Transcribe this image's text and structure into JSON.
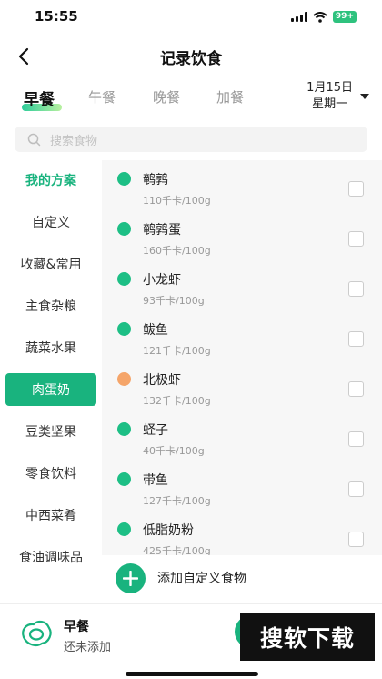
{
  "status_bar": {
    "time": "15:55",
    "battery": "99+"
  },
  "nav": {
    "title": "记录饮食"
  },
  "meal_tabs": [
    {
      "label": "早餐",
      "active": true
    },
    {
      "label": "午餐",
      "active": false
    },
    {
      "label": "晚餐",
      "active": false
    },
    {
      "label": "加餐",
      "active": false
    }
  ],
  "date": {
    "day": "1月15日",
    "weekday": "星期一"
  },
  "search": {
    "placeholder": "搜索食物"
  },
  "sidebar": {
    "items": [
      {
        "label": "我的方案",
        "state": "highlight"
      },
      {
        "label": "自定义",
        "state": "normal"
      },
      {
        "label": "收藏&常用",
        "state": "normal"
      },
      {
        "label": "主食杂粮",
        "state": "normal"
      },
      {
        "label": "蔬菜水果",
        "state": "normal"
      },
      {
        "label": "肉蛋奶",
        "state": "selected"
      },
      {
        "label": "豆类坚果",
        "state": "normal"
      },
      {
        "label": "零食饮料",
        "state": "normal"
      },
      {
        "label": "中西菜肴",
        "state": "normal"
      },
      {
        "label": "食油调味品",
        "state": "normal"
      }
    ]
  },
  "foods": [
    {
      "name": "鹌鹑",
      "calories": "110千卡/100g",
      "dot_color": "#1dbf85"
    },
    {
      "name": "鹌鹑蛋",
      "calories": "160千卡/100g",
      "dot_color": "#1dbf85"
    },
    {
      "name": "小龙虾",
      "calories": "93千卡/100g",
      "dot_color": "#1dbf85"
    },
    {
      "name": "鲅鱼",
      "calories": "121千卡/100g",
      "dot_color": "#1dbf85"
    },
    {
      "name": "北极虾",
      "calories": "132千卡/100g",
      "dot_color": "#f5a56a"
    },
    {
      "name": "蛏子",
      "calories": "40千卡/100g",
      "dot_color": "#1dbf85"
    },
    {
      "name": "带鱼",
      "calories": "127千卡/100g",
      "dot_color": "#1dbf85"
    },
    {
      "name": "低脂奶粉",
      "calories": "425千卡/100g",
      "dot_color": "#1dbf85"
    }
  ],
  "add_custom": {
    "label": "添加自定义食物"
  },
  "bottom": {
    "meal": "早餐",
    "status": "还未添加",
    "watermark": "搜软下载"
  },
  "colors": {
    "accent": "#19b37e"
  }
}
